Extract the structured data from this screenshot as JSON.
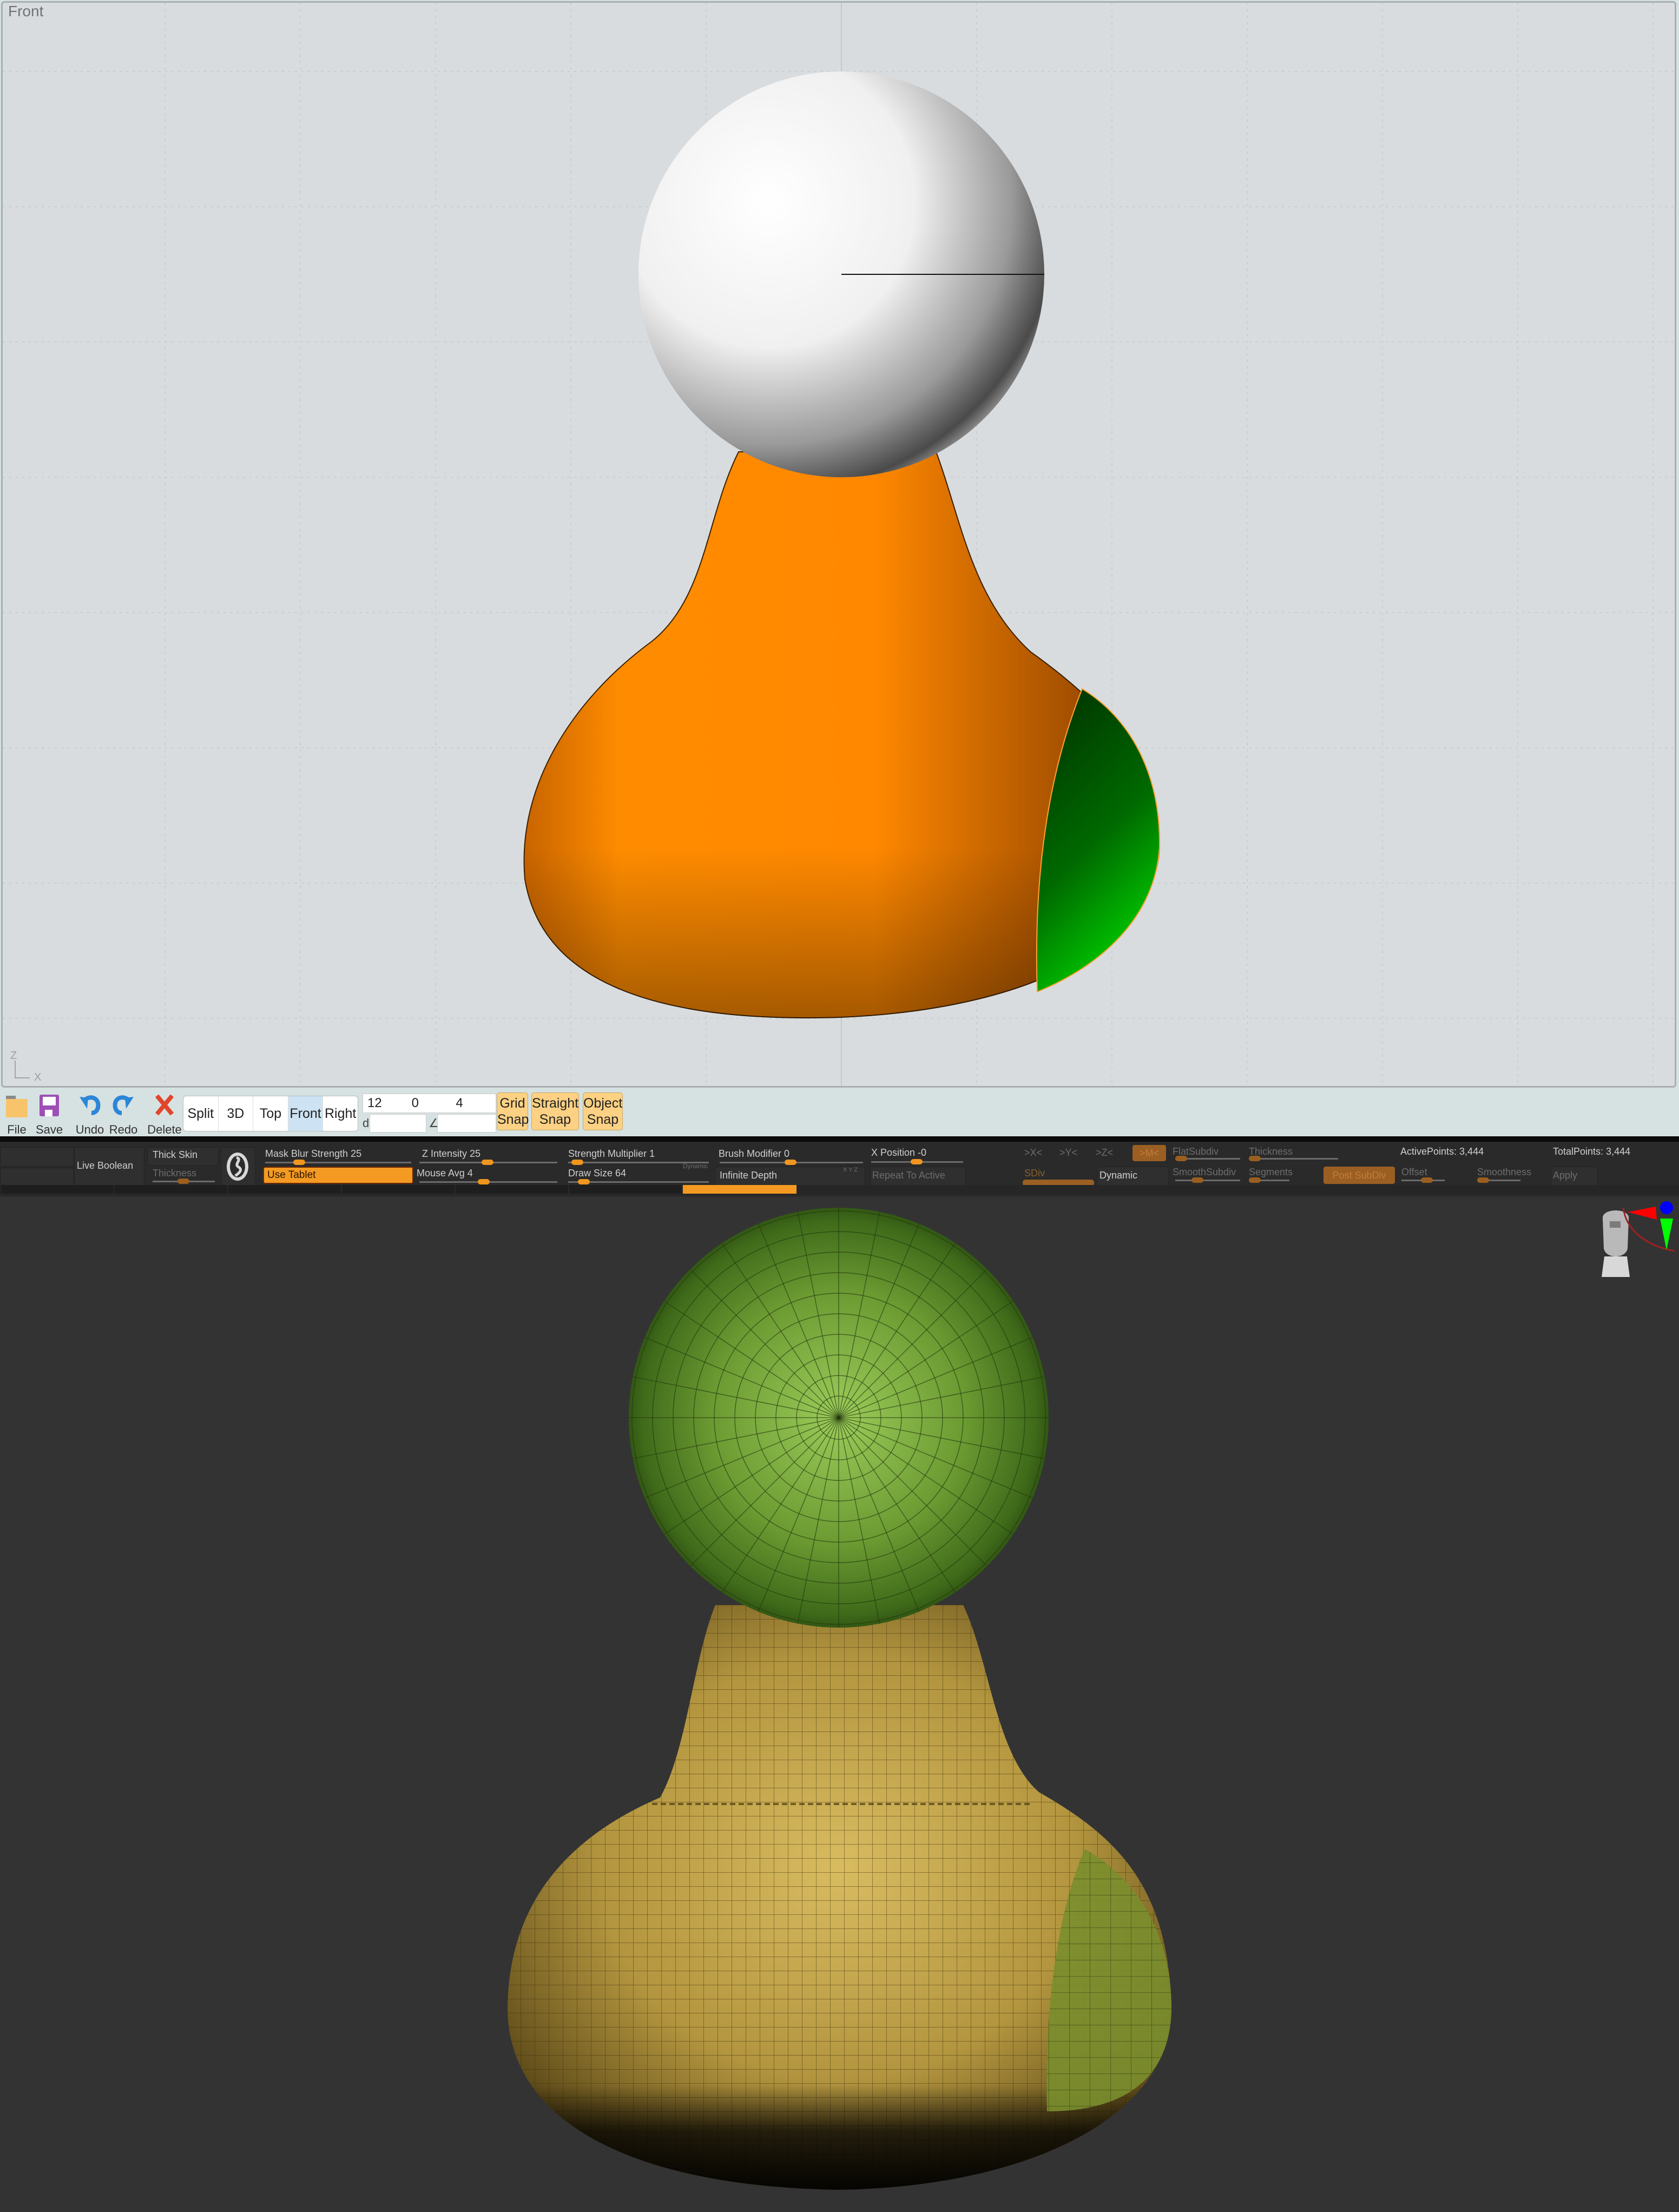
{
  "cad_viewport": {
    "view_label": "Front",
    "axis_labels": {
      "vertical": "Z",
      "horizontal": "X"
    },
    "colors": {
      "background": "#d9dcdf",
      "sphere": "#f2f2f2",
      "body": "#ff8a00",
      "boolean_region": "#00c800"
    }
  },
  "toolbar": {
    "buttons": [
      {
        "id": "file",
        "label": "File",
        "icon": "folder-icon"
      },
      {
        "id": "save",
        "label": "Save",
        "icon": "floppy-disk-icon"
      },
      {
        "id": "undo",
        "label": "Undo",
        "icon": "undo-arrow-icon"
      },
      {
        "id": "redo",
        "label": "Redo",
        "icon": "redo-arrow-icon"
      },
      {
        "id": "delete",
        "label": "Delete",
        "icon": "red-x-icon"
      }
    ],
    "view_modes": [
      "Split",
      "3D",
      "Top",
      "Front",
      "Right"
    ],
    "active_view": "Front",
    "coordinates": [
      "12",
      "0",
      "4"
    ],
    "distance_label": "d",
    "distance_value": "",
    "angle_label": "∠",
    "angle_value": "",
    "snap_buttons": [
      {
        "line1": "Grid",
        "line2": "Snap"
      },
      {
        "line1": "Straight",
        "line2": "Snap"
      },
      {
        "line1": "Object",
        "line2": "Snap"
      }
    ]
  },
  "zbrush_panel": {
    "live_boolean": "Live Boolean",
    "thick_skin": "Thick Skin",
    "thickness": "Thickness",
    "mask_blur_strength": "Mask Blur Strength 25",
    "use_tablet": "Use Tablet",
    "z_intensity": "Z Intensity 25",
    "mouse_avg": "Mouse Avg 4",
    "strength_multiplier": "Strength Multiplier 1",
    "draw_size": "Draw Size 64",
    "dynamic_tag": "Dynamic",
    "brush_modifier": "Brush Modifier 0",
    "infinite_depth": "Infinite Depth",
    "xyz_small": "X Y Z",
    "x_position": "X Position -0",
    "repeat_to_active": "Repeat To Active",
    "sym_x": ">X<",
    "sym_y": ">Y<",
    "sym_z": ">Z<",
    "sym_m": ">M<",
    "sdiv": "SDiv",
    "dynamic": "Dynamic",
    "flat_subdiv": "FlatSubdiv",
    "smooth_subdiv": "SmoothSubdiv",
    "thickness2": "Thickness",
    "segments": "Segments",
    "post_subdiv": "Post SubDiv",
    "offset": "Offset",
    "smoothness": "Smoothness",
    "active_points": "ActivePoints: 3,444",
    "total_points": "TotalPoints: 3,444",
    "apply": "Apply",
    "slider_values": {
      "mask_blur_strength": 0.25,
      "z_intensity": 0.25,
      "mouse_avg": 0.4,
      "strength_multiplier": 0.05,
      "draw_size": 0.1,
      "brush_modifier": 0.5,
      "x_position": 0.5
    }
  },
  "zbrush_viewport": {
    "colors": {
      "background": "#333333",
      "sphere": "#6a9a2e",
      "body": "#c8a94e",
      "boolean_region": "#7a8e2e"
    },
    "navigation_widget": "head-gizmo"
  }
}
